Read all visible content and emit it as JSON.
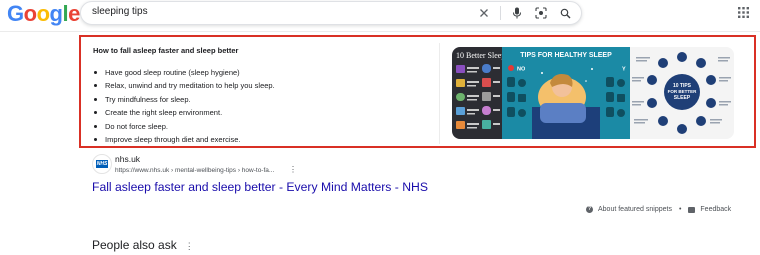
{
  "header": {
    "logo_text": "Google",
    "logo_colors": [
      "#4285F4",
      "#EA4335",
      "#FBBC05",
      "#4285F4",
      "#34A853",
      "#EA4335"
    ],
    "search": {
      "query": "sleeping tips"
    },
    "icons": [
      "clear-icon",
      "microphone-icon",
      "lens-icon",
      "search-icon",
      "apps-grid-icon"
    ]
  },
  "snippet": {
    "title": "How to fall asleep faster and sleep better",
    "bullets": [
      "Have good sleep routine (sleep hygiene)",
      "Relax, unwind and try meditation to help you sleep.",
      "Try mindfulness for sleep.",
      "Create the right sleep environment.",
      "Do not force sleep.",
      "Improve sleep through diet and exercise."
    ],
    "highlight_color": "#d93025",
    "images": {
      "img1_text": "10 Better Sleep",
      "img2_title": "TIPS FOR HEALTHY SLEEP",
      "img2_no": "NO",
      "img2_yes": "Y",
      "img3_center": [
        "10 TIPS",
        "FOR BETTER",
        "SLEEP"
      ]
    }
  },
  "result": {
    "favicon_text": "NHS",
    "site_name": "nhs.uk",
    "url": "https://www.nhs.uk › mental-wellbeing-tips › how-to-fa...",
    "title": "Fall asleep faster and sleep better - Every Mind Matters - NHS",
    "link_color": "#1a0dab"
  },
  "footer": {
    "about_label": "About featured snippets",
    "separator": "•",
    "feedback_label": "Feedback"
  },
  "people_also_ask": {
    "heading": "People also ask"
  }
}
